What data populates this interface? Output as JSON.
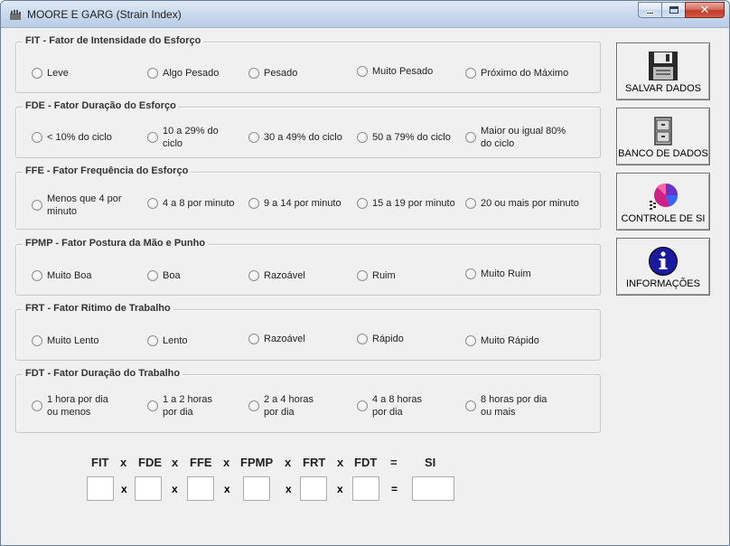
{
  "window": {
    "title": "MOORE E GARG (Strain Index)",
    "close_glyph": "✕",
    "icons": {
      "app": "hand-icon",
      "minimize": "minimize-icon",
      "maximize": "maximize-icon",
      "close": "close-icon"
    }
  },
  "groups": [
    {
      "title": "FIT - Fator de Intensidade do Esforço",
      "options": [
        "Leve",
        "Algo Pesado",
        "Pesado",
        "Muito Pesado",
        "Próximo do Máximo"
      ]
    },
    {
      "title": "FDE - Fator Duração do Esforço",
      "options": [
        "< 10% do ciclo",
        "10 a 29% do\nciclo",
        "30 a 49% do ciclo",
        "50 a 79% do ciclo",
        "Maior ou igual 80%\ndo ciclo"
      ]
    },
    {
      "title": "FFE - Fator Frequência do Esforço",
      "options": [
        "Menos que 4 por\nminuto",
        "4 a 8 por minuto",
        "9 a 14 por minuto",
        "15 a 19 por minuto",
        "20 ou mais por minuto"
      ]
    },
    {
      "title": "FPMP - Fator Postura da Mão e Punho",
      "options": [
        "Muito Boa",
        "Boa",
        "Razoável",
        "Ruim",
        "Muito Ruim"
      ]
    },
    {
      "title": "FRT - Fator Ritimo de Trabalho",
      "options": [
        "Muito Lento",
        "Lento",
        "Razoável",
        "Rápido",
        "Muito Rápido"
      ]
    },
    {
      "title": "FDT - Fator Duração do Trabalho",
      "options": [
        "1 hora por dia\nou menos",
        "1 a 2 horas\npor dia",
        "2 a 4 horas\npor dia",
        "4 a 8 horas\npor dia",
        "8 horas por dia\nou mais"
      ]
    }
  ],
  "side_buttons": [
    {
      "label": "SALVAR DADOS",
      "icon": "floppy-disk-icon"
    },
    {
      "label": "BANCO DE DADOS",
      "icon": "file-cabinet-icon"
    },
    {
      "label": "CONTROLE DE SI",
      "icon": "pie-chart-icon"
    },
    {
      "label": "INFORMAÇÕES",
      "icon": "info-icon"
    }
  ],
  "formula": {
    "labels": [
      "FIT",
      "FDE",
      "FFE",
      "FPMP",
      "FRT",
      "FDT",
      "SI"
    ],
    "times": "x",
    "equals": "=",
    "values": [
      "",
      "",
      "",
      "",
      "",
      "",
      ""
    ]
  },
  "colors": {
    "window_bg": "#f0f0f0",
    "close_button": "#c1382b",
    "info_icon": "#1a1a9e",
    "pie_icon_primary": "#cc2288"
  }
}
